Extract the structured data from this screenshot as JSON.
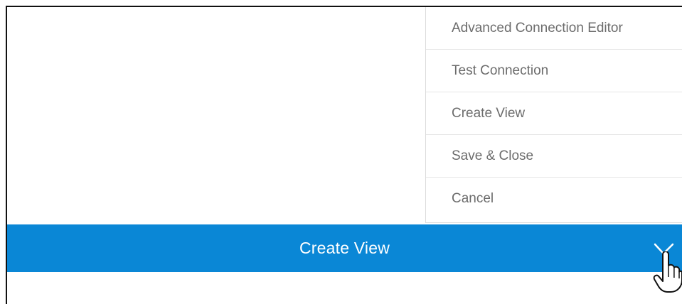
{
  "menu": {
    "items": [
      {
        "label": "Advanced Connection Editor"
      },
      {
        "label": "Test Connection"
      },
      {
        "label": "Create View"
      },
      {
        "label": "Save & Close"
      },
      {
        "label": "Cancel"
      }
    ]
  },
  "action_bar": {
    "label": "Create View",
    "background_color": "#0a87d6",
    "toggle_icon": "chevron-down-icon"
  },
  "cursor": {
    "icon": "hand-pointer-icon"
  }
}
